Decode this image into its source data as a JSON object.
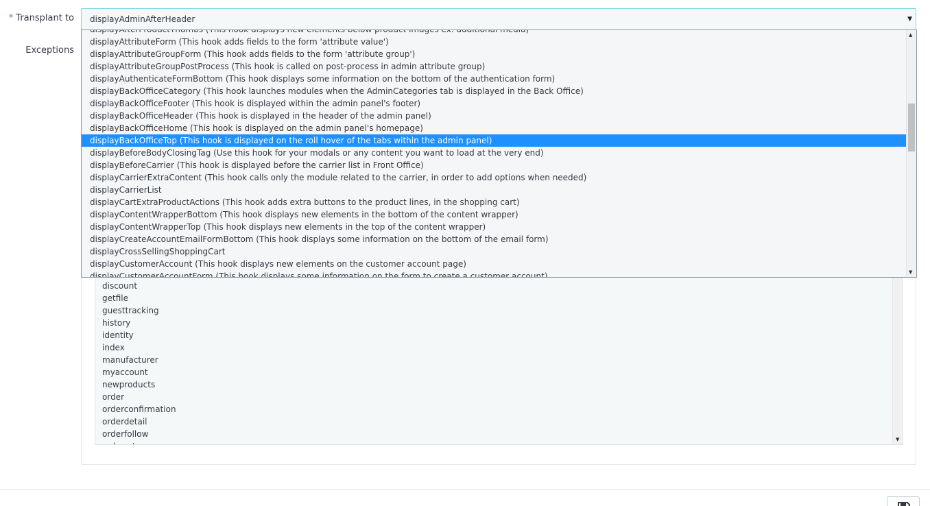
{
  "form": {
    "transplant_label": "Transplant to",
    "required_mark": "*",
    "selected_hook": "displayAdminAfterHeader",
    "exceptions_label": "Exceptions"
  },
  "dropdown": {
    "options": [
      "displayAfterProductThumbs (This hook displays new elements below product images ex: additional media)",
      "displayAttributeForm (This hook adds fields to the form 'attribute value')",
      "displayAttributeGroupForm (This hook adds fields to the form 'attribute group')",
      "displayAttributeGroupPostProcess (This hook is called on post-process in admin attribute group)",
      "displayAuthenticateFormBottom (This hook displays some information on the bottom of the authentication form)",
      "displayBackOfficeCategory (This hook launches modules when the AdminCategories tab is displayed in the Back Office)",
      "displayBackOfficeFooter (This hook is displayed within the admin panel's footer)",
      "displayBackOfficeHeader (This hook is displayed in the header of the admin panel)",
      "displayBackOfficeHome (This hook is displayed on the admin panel's homepage)",
      "displayBackOfficeTop (This hook is displayed on the roll hover of the tabs within the admin panel)",
      "displayBeforeBodyClosingTag (Use this hook for your modals or any content you want to load at the very end)",
      "displayBeforeCarrier (This hook is displayed before the carrier list in Front Office)",
      "displayCarrierExtraContent (This hook calls only the module related to the carrier, in order to add options when needed)",
      "displayCarrierList",
      "displayCartExtraProductActions (This hook adds extra buttons to the product lines, in the shopping cart)",
      "displayContentWrapperBottom (This hook displays new elements in the bottom of the content wrapper)",
      "displayContentWrapperTop (This hook displays new elements in the top of the content wrapper)",
      "displayCreateAccountEmailFormBottom (This hook displays some information on the bottom of the email form)",
      "displayCrossSellingShoppingCart",
      "displayCustomerAccount (This hook displays new elements on the customer account page)",
      "displayCustomerAccountForm (This hook displays some information on the form to create a customer account)"
    ],
    "highlighted_index": 9
  },
  "exceptions": {
    "items": [
      "discount",
      "getfile",
      "guesttracking",
      "history",
      "identity",
      "index",
      "manufacturer",
      "myaccount",
      "newproducts",
      "order",
      "orderconfirmation",
      "orderdetail",
      "orderfollow",
      "orderreturn"
    ]
  },
  "icons": {
    "select_arrow": "caret-down-icon",
    "save": "floppy-disk-icon"
  },
  "colors": {
    "highlight": "#1e90ff",
    "required": "#c05c67",
    "focus_border": "#7cd5e7"
  }
}
